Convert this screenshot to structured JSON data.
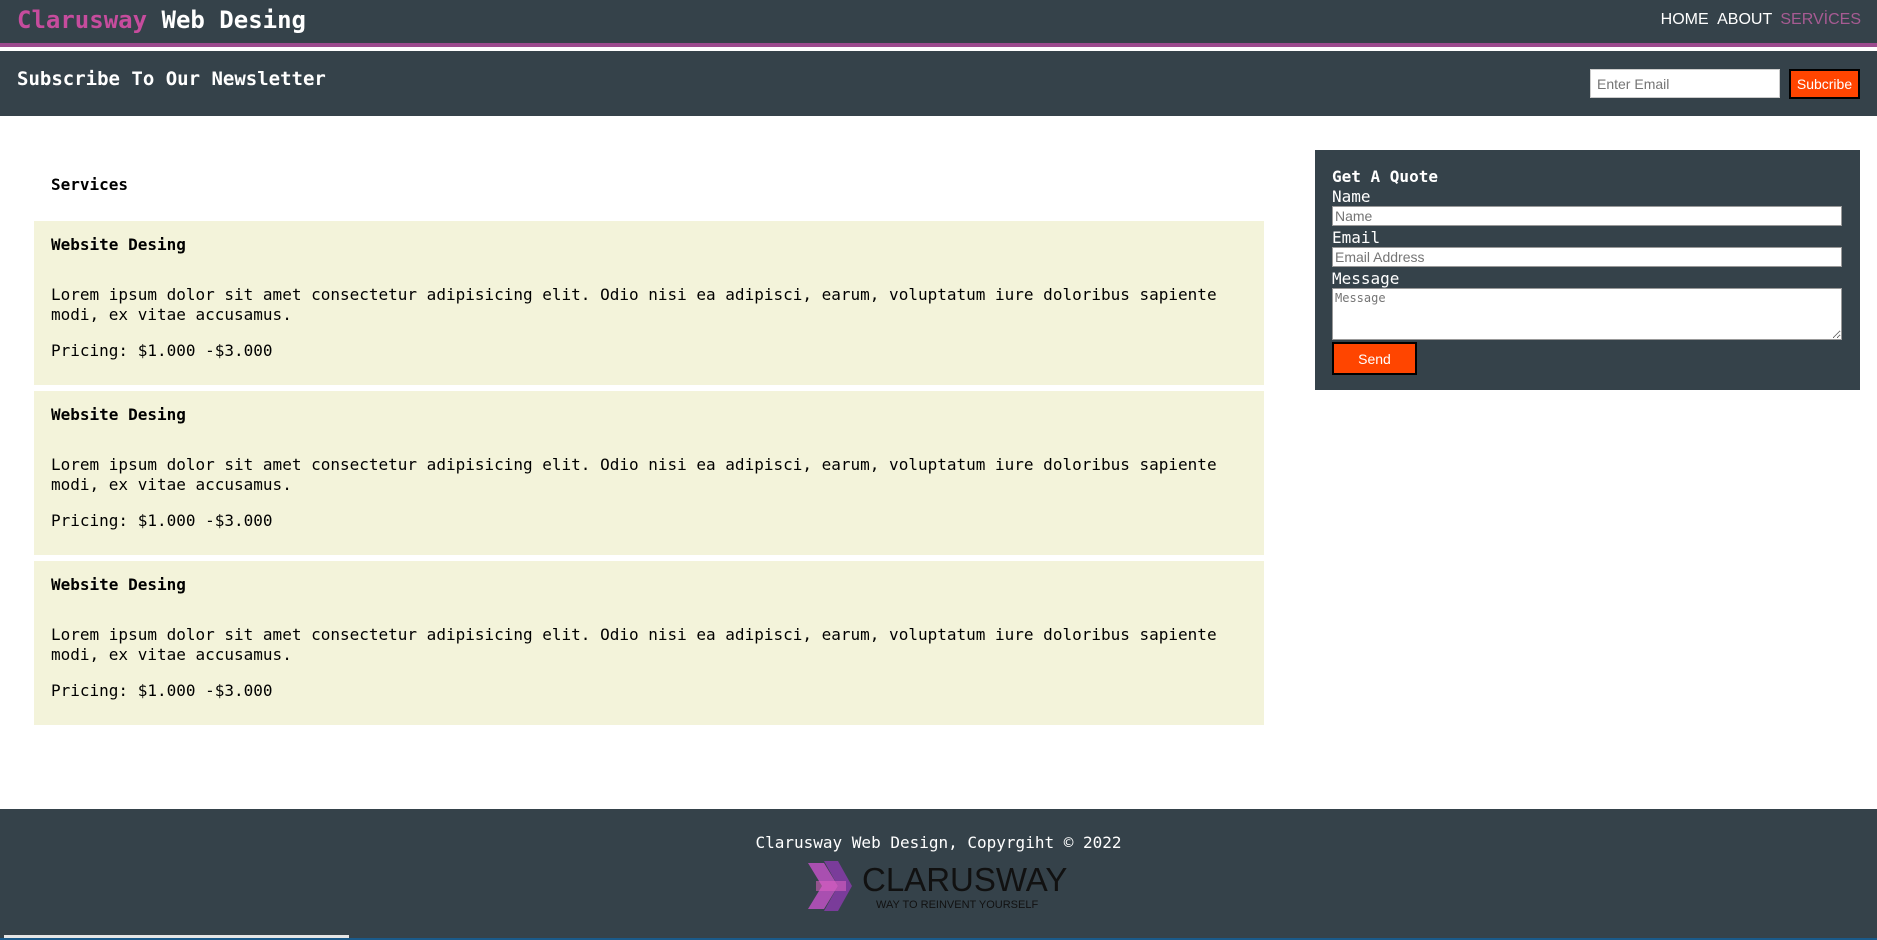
{
  "header": {
    "brand_highlight": "Clarusway",
    "brand_rest": "Web Desing",
    "nav": [
      {
        "label": "HOME"
      },
      {
        "label": "ABOUT"
      },
      {
        "label": "SERVİCES"
      }
    ]
  },
  "newsletter": {
    "title": "Subscribe To Our Newsletter",
    "email_placeholder": "Enter Email",
    "button_label": "Subcribe"
  },
  "services": {
    "title": "Services",
    "cards": [
      {
        "title": "Website Desing",
        "description": "Lorem ipsum dolor sit amet consectetur adipisicing elit. Odio nisi ea adipisci, earum, voluptatum iure doloribus sapiente modi, ex vitae accusamus.",
        "price": "Pricing: $1.000 -$3.000"
      },
      {
        "title": "Website Desing",
        "description": "Lorem ipsum dolor sit amet consectetur adipisicing elit. Odio nisi ea adipisci, earum, voluptatum iure doloribus sapiente modi, ex vitae accusamus.",
        "price": "Pricing: $1.000 -$3.000"
      },
      {
        "title": "Website Desing",
        "description": "Lorem ipsum dolor sit amet consectetur adipisicing elit. Odio nisi ea adipisci, earum, voluptatum iure doloribus sapiente modi, ex vitae accusamus.",
        "price": "Pricing: $1.000 -$3.000"
      }
    ]
  },
  "quote": {
    "title": "Get A Quote",
    "name_label": "Name",
    "name_placeholder": "Name",
    "email_label": "Email",
    "email_placeholder": "Email Address",
    "message_label": "Message",
    "message_placeholder": "Message",
    "send_label": "Send"
  },
  "footer": {
    "copyright": "Clarusway Web Design, Copyrgiht © 2022",
    "logo_text": "CLARUSWAY",
    "logo_tagline": "WAY TO REINVENT YOURSELF"
  },
  "colors": {
    "dark": "#35424a",
    "accent": "#c64c9d",
    "orange": "#ff4500",
    "card": "#f3f3da"
  }
}
